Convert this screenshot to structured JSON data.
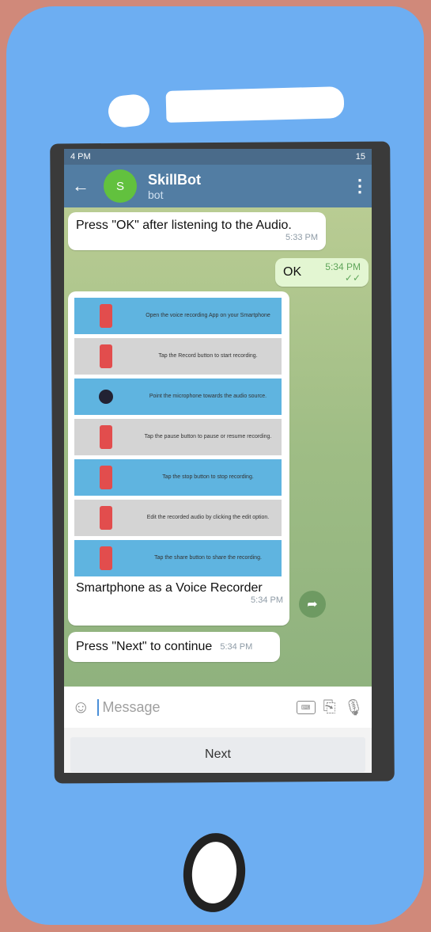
{
  "status": {
    "left": "4 PM",
    "right": "15"
  },
  "header": {
    "avatar_letter": "S",
    "bot_name": "SkillBot",
    "subtitle": "bot"
  },
  "messages": [
    {
      "text": "Press \"OK\" after listening to the Audio.",
      "time": "5:33 PM"
    },
    {
      "text": "OK",
      "time": "5:34 PM"
    },
    {
      "caption": "Smartphone as a Voice Recorder",
      "time": "5:34 PM"
    },
    {
      "text": "Press \"Next\" to continue",
      "time": "5:34 PM"
    }
  ],
  "steps": [
    "Open the voice recording App on your Smartphone",
    "Tap the Record button to start recording.",
    "Point the microphone towards the audio source.",
    "Tap the pause button to pause or resume recording.",
    "Tap the stop button to stop recording.",
    "Edit the recorded audio by clicking the edit option.",
    "Tap the share button to share the recording."
  ],
  "input": {
    "placeholder": "Message"
  },
  "keyboard": {
    "next_label": "Next"
  },
  "colors": {
    "appbar": "#527da3",
    "avatar": "#62c13e",
    "sent_bubble": "#e3f6d2",
    "phone": "#6daef2",
    "background": "#d0897a"
  }
}
